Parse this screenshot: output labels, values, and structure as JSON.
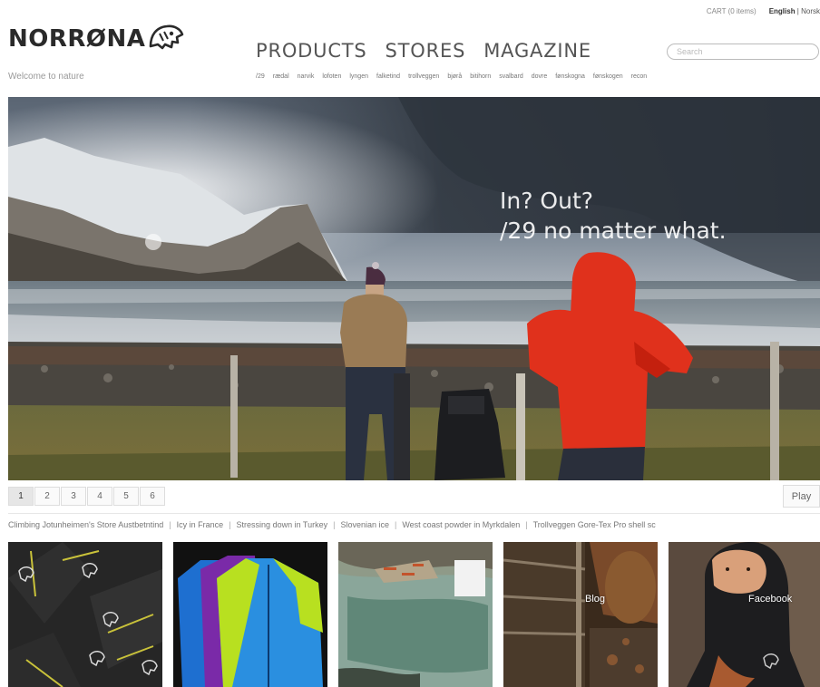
{
  "topbar": {
    "cart": "CART (0 items)",
    "lang_active": "English",
    "lang_sep": " | ",
    "lang_other": "Norsk"
  },
  "brand": {
    "logo_text": "NORRØNA",
    "tagline": "Welcome to nature"
  },
  "nav": {
    "main": [
      "PRODUCTS",
      "STORES",
      "MAGAZINE"
    ],
    "sub": [
      "/29",
      "rædal",
      "narvik",
      "lofoten",
      "lyngen",
      "falketind",
      "trollveggen",
      "bjørå",
      "bitihorn",
      "svalbard",
      "dovre",
      "fønskogna",
      "fønskogen",
      "recon"
    ]
  },
  "search": {
    "placeholder": "Search"
  },
  "hero": {
    "line1": "In? Out?",
    "line2": "/29 no matter what."
  },
  "slider": {
    "pages": [
      "1",
      "2",
      "3",
      "4",
      "5",
      "6"
    ],
    "active_page": 1,
    "play_label": "Play"
  },
  "ticker": {
    "items": [
      "Climbing Jotunheimen's Store Austbetntind",
      "Icy in France",
      "Stressing down in Turkey",
      "Slovenian ice",
      "West coast powder in Myrkdalen",
      "Trollveggen Gore-Tex Pro shell sc"
    ],
    "separator": "|"
  },
  "tiles": {
    "blog_label": "Blog",
    "facebook_label": "Facebook"
  },
  "colors": {
    "accent_red": "#e0311c",
    "text_grey": "#555555",
    "brand_dark": "#2a2a2a"
  }
}
